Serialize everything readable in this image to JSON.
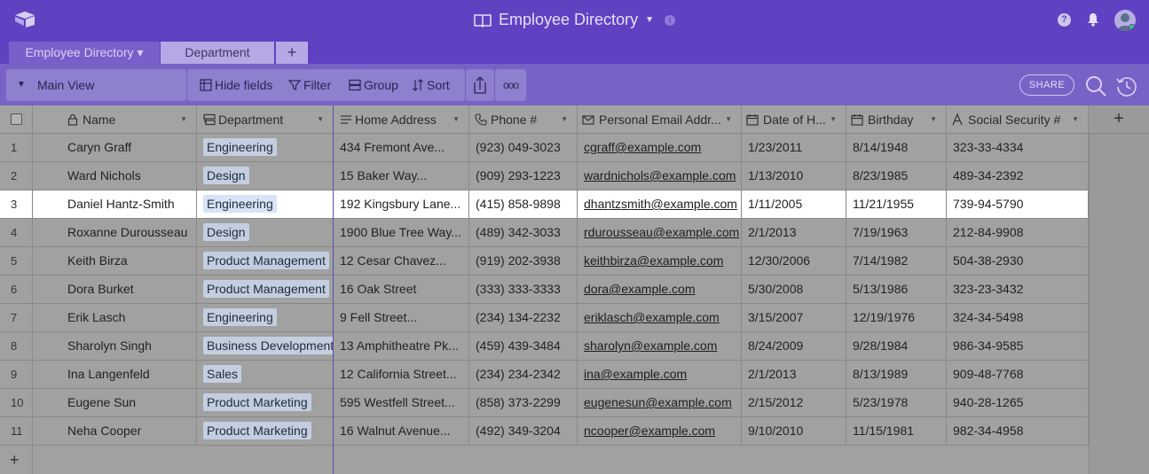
{
  "app": {
    "title": "Employee Directory",
    "colors": {
      "topbar": "#6041c2",
      "viewbar": "#7862c6",
      "pill": "#c3cfe0",
      "selected_row": "#ffffff"
    }
  },
  "tabs": [
    {
      "label": "Employee Directory ▾",
      "active": true
    },
    {
      "label": "Department",
      "active": false
    },
    {
      "label": "+",
      "active": false
    }
  ],
  "viewbar": {
    "view_name": "Main View",
    "tools": [
      "Hide fields",
      "Filter",
      "Group",
      "Sort"
    ],
    "more": "ooo",
    "share": "SHARE"
  },
  "columns": [
    {
      "label": "Name",
      "icon": "lock-icon"
    },
    {
      "label": "Department",
      "icon": "link-record-icon"
    },
    {
      "label": "Home Address",
      "icon": "text-icon"
    },
    {
      "label": "Phone #",
      "icon": "phone-icon"
    },
    {
      "label": "Personal Email Addr...",
      "icon": "email-icon"
    },
    {
      "label": "Date of H...",
      "icon": "calendar-icon"
    },
    {
      "label": "Birthday",
      "icon": "calendar-icon"
    },
    {
      "label": "Social Security #",
      "icon": "text-field-icon"
    }
  ],
  "rows": [
    {
      "n": "1",
      "name": "Caryn Graff",
      "dept": "Engineering",
      "address": "434 Fremont Ave...",
      "phone": "(923) 049-3023",
      "email": "cgraff@example.com",
      "hire": "1/23/2011",
      "birthday": "8/14/1948",
      "ssn": "323-33-4334"
    },
    {
      "n": "2",
      "name": "Ward Nichols",
      "dept": "Design",
      "address": "15 Baker Way...",
      "phone": "(909) 293-1223",
      "email": "wardnichols@example.com",
      "hire": "1/13/2010",
      "birthday": "8/23/1985",
      "ssn": "489-34-2392"
    },
    {
      "n": "3",
      "name": "Daniel Hantz-Smith",
      "dept": "Engineering",
      "address": "192 Kingsbury Lane...",
      "phone": "(415) 858-9898",
      "email": "dhantzsmith@example.com",
      "hire": "1/11/2005",
      "birthday": "11/21/1955",
      "ssn": "739-94-5790"
    },
    {
      "n": "4",
      "name": "Roxanne Durousseau",
      "dept": "Design",
      "address": "1900 Blue Tree Way...",
      "phone": "(489) 342-3033",
      "email": "rdurousseau@example.com",
      "hire": "2/1/2013",
      "birthday": "7/19/1963",
      "ssn": "212-84-9908"
    },
    {
      "n": "5",
      "name": "Keith Birza",
      "dept": "Product Management",
      "address": "12 Cesar Chavez...",
      "phone": "(919) 202-3938",
      "email": "keithbirza@example.com",
      "hire": "12/30/2006",
      "birthday": "7/14/1982",
      "ssn": "504-38-2930"
    },
    {
      "n": "6",
      "name": "Dora Burket",
      "dept": "Product Management",
      "address": "16 Oak Street",
      "phone": "(333) 333-3333",
      "email": "dora@example.com",
      "hire": "5/30/2008",
      "birthday": "5/13/1986",
      "ssn": "323-23-3432"
    },
    {
      "n": "7",
      "name": "Erik Lasch",
      "dept": "Engineering",
      "address": "9 Fell Street...",
      "phone": "(234) 134-2232",
      "email": "eriklasch@example.com",
      "hire": "3/15/2007",
      "birthday": "12/19/1976",
      "ssn": "324-34-5498"
    },
    {
      "n": "8",
      "name": "Sharolyn Singh",
      "dept": "Business Development",
      "address": "13 Amphitheatre Pk...",
      "phone": "(459) 439-3484",
      "email": "sharolyn@example.com",
      "hire": "8/24/2009",
      "birthday": "9/28/1984",
      "ssn": "986-34-9585"
    },
    {
      "n": "9",
      "name": "Ina Langenfeld",
      "dept": "Sales",
      "address": "12 California Street...",
      "phone": "(234) 234-2342",
      "email": "ina@example.com",
      "hire": "2/1/2013",
      "birthday": "8/13/1989",
      "ssn": "909-48-7768"
    },
    {
      "n": "10",
      "name": "Eugene Sun",
      "dept": "Product Marketing",
      "address": "595 Westfell Street...",
      "phone": "(858) 373-2299",
      "email": "eugenesun@example.com",
      "hire": "2/15/2012",
      "birthday": "5/23/1978",
      "ssn": "940-28-1265"
    },
    {
      "n": "11",
      "name": "Neha Cooper",
      "dept": "Product Marketing",
      "address": "16 Walnut Avenue...",
      "phone": "(492) 349-3204",
      "email": "ncooper@example.com",
      "hire": "9/10/2010",
      "birthday": "11/15/1981",
      "ssn": "982-34-4958"
    }
  ],
  "selected_row": 3
}
